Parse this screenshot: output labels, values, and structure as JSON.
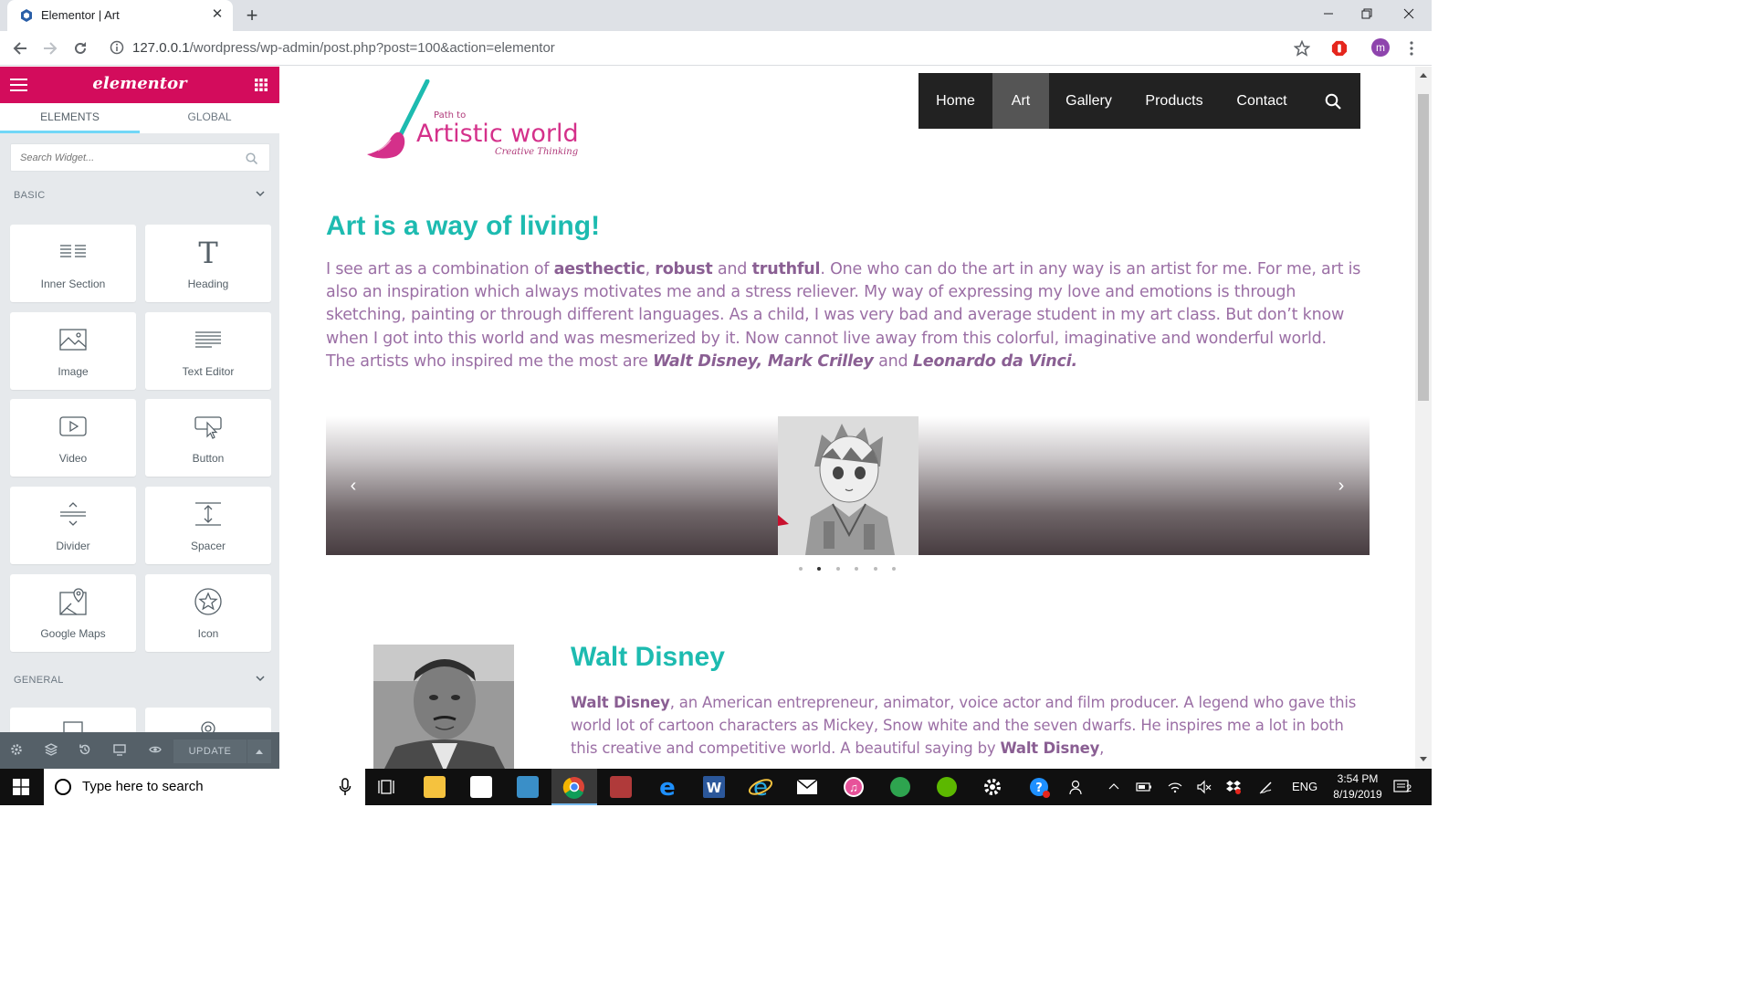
{
  "browser": {
    "tab_title": "Elementor | Art",
    "close_glyph": "✕",
    "new_tab_glyph": "+",
    "url_host": "127.0.0.1",
    "url_path": "/wordpress/wp-admin/post.php?post=100&action=elementor",
    "profile_initial": "m"
  },
  "elementor": {
    "logo": "elementor",
    "tabs": [
      "ELEMENTS",
      "GLOBAL"
    ],
    "search_placeholder": "Search Widget...",
    "category_basic": "BASIC",
    "category_general": "GENERAL",
    "widgets": [
      {
        "label": "Inner Section",
        "icon": "inner-section-icon"
      },
      {
        "label": "Heading",
        "icon": "heading-icon"
      },
      {
        "label": "Image",
        "icon": "image-icon"
      },
      {
        "label": "Text Editor",
        "icon": "text-editor-icon"
      },
      {
        "label": "Video",
        "icon": "video-icon"
      },
      {
        "label": "Button",
        "icon": "button-icon"
      },
      {
        "label": "Divider",
        "icon": "divider-icon"
      },
      {
        "label": "Spacer",
        "icon": "spacer-icon"
      },
      {
        "label": "Google Maps",
        "icon": "map-icon"
      },
      {
        "label": "Icon",
        "icon": "star-icon"
      }
    ],
    "update_label": "UPDATE"
  },
  "site": {
    "logo_small": "Path to",
    "logo_main": "Artistic world",
    "logo_tagline": "Creative Thinking",
    "nav": [
      "Home",
      "Art",
      "Gallery",
      "Products",
      "Contact"
    ],
    "nav_active": "Art",
    "heading": "Art is a way of living!",
    "intro": {
      "p1_a": "I see art as a combination of ",
      "w1": "aesthectic",
      "sep1": ", ",
      "w2": "robust",
      "sep2": " and ",
      "w3": "truthful",
      "p1_b": ". One who can do the art in any way is an artist for me. For me, art is also an inspiration which always motivates me and a stress reliever. My way of expressing my love and emotions is through sketching, painting or through different languages. As a child, I was very bad and average student in my art class. But don’t know when I got into this world and was mesmerized by it. Now cannot live away from this colorful, imaginative and wonderful world.",
      "p2_a": "The artists who inspired me the most are ",
      "artists_a": "Walt Disney, Mark Crilley",
      "p2_b": " and ",
      "artists_b": "Leonardo da Vinci."
    },
    "slider_prev": "‹",
    "slider_next": "›",
    "slider_dots": 6,
    "slider_active_dot": 1,
    "section_title": "Walt Disney",
    "walt": {
      "name": "Walt Disney",
      "text_a": ", an American entrepreneur, animator, voice actor and film producer. A legend who gave this world lot of cartoon characters as Mickey, Snow white and the seven dwarfs. He inspires me a lot in both this creative and competitive world. A beautiful saying by ",
      "name2": "Walt Disney",
      "text_b": ","
    }
  },
  "taskbar": {
    "search_text": "Type here to search",
    "language": "ENG",
    "time": "3:54 PM",
    "date": "8/19/2019",
    "notifications": "2"
  },
  "colors": {
    "elementor_pink": "#d30c5c",
    "heading_teal": "#1dbbb0",
    "body_purple": "#9b6fa5",
    "nav_dark": "#222222"
  }
}
